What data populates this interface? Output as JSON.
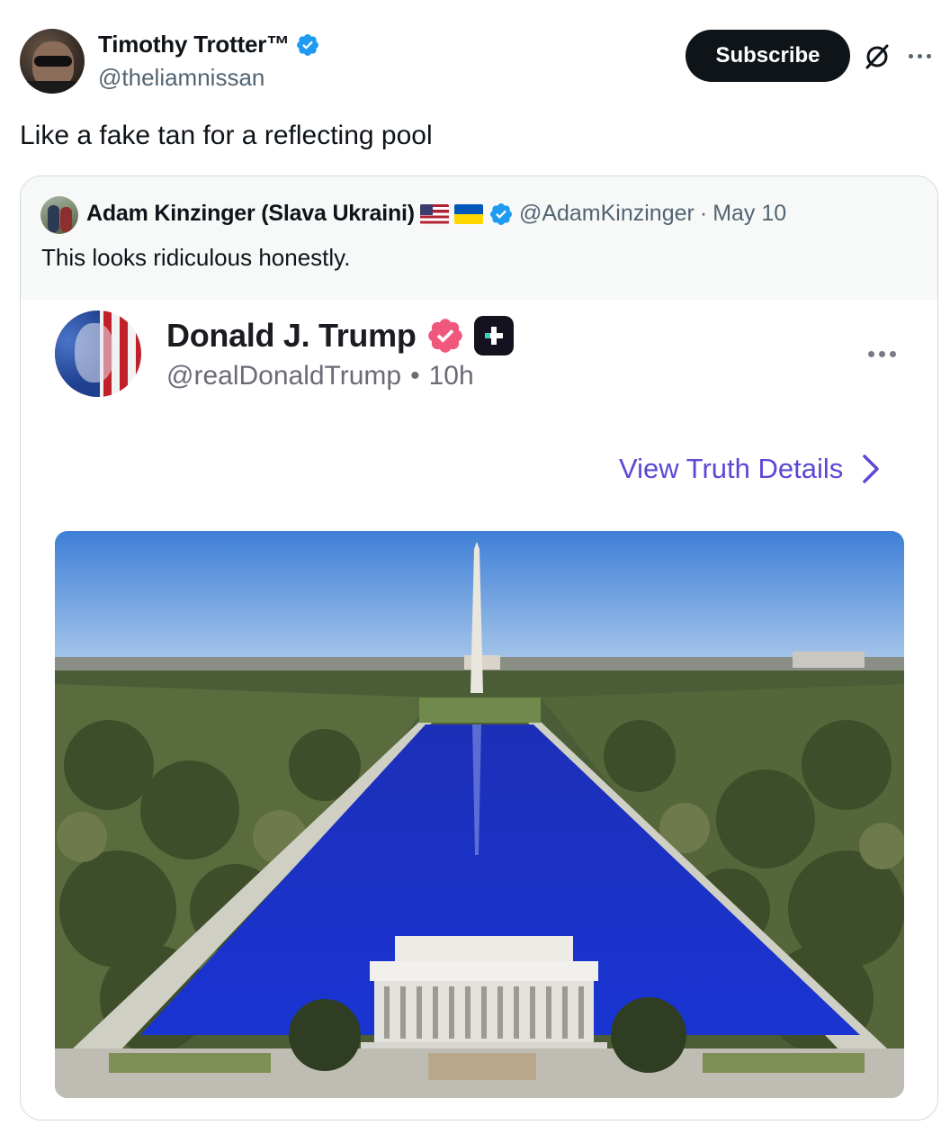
{
  "tweet": {
    "author_name": "Timothy Trotter™",
    "author_handle": "@theliamnissan",
    "subscribe_label": "Subscribe",
    "text": "Like a fake tan for a reflecting pool"
  },
  "quote": {
    "author_name": "Adam Kinzinger (Slava Ukraini)",
    "author_handle": "@AdamKinzinger",
    "separator": "·",
    "date": "May 10",
    "text": "This looks ridiculous honestly."
  },
  "embedded": {
    "name": "Donald J. Trump",
    "handle": "@realDonaldTrump",
    "separator": "•",
    "time": "10h",
    "view_link": "View Truth Details"
  },
  "colors": {
    "verified_blue": "#1d9bf0",
    "truth_badge": "#f0577c",
    "link_purple": "#5b49d6",
    "pool_blue": "#1532c8"
  },
  "icons": [
    "verified-badge-icon",
    "grok-icon",
    "more-icon",
    "flag-us-icon",
    "flag-ua-icon",
    "truth-verified-icon",
    "truth-plus-icon",
    "chevron-right-icon"
  ]
}
